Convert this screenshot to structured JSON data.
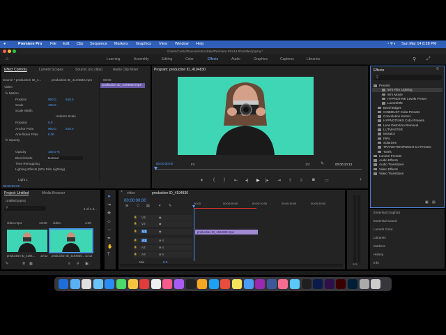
{
  "menubar": {
    "app": "Premiere Pro",
    "items": [
      "File",
      "Edit",
      "Clip",
      "Sequence",
      "Markers",
      "Graphics",
      "View",
      "Window",
      "Help"
    ],
    "datetime": "Sun Mar 14  8:28 PM"
  },
  "path": "/Users/Curtis/Documents/Adobe/Premiere Pro/14.0/Untitled.prproj *",
  "workspaces": [
    "Learning",
    "Assembly",
    "Editing",
    "Color",
    "Effects",
    "Audio",
    "Graphics",
    "Captions",
    "Libraries"
  ],
  "workspace_active": "Effects",
  "effect_controls": {
    "tabs": [
      "Effect Controls",
      "Lumetri Scopes",
      "Source: (no clips)",
      "Audio Clip Mixer"
    ],
    "source_label": "Source * production ID_4...",
    "clip_label": "production ID_4194830.mp4",
    "timecode_top": "00:00",
    "video_header": "Video",
    "rows": [
      {
        "label": "fx  Motion",
        "v1": "",
        "v2": ""
      },
      {
        "label": "Position",
        "v1": "960.0",
        "v2": "540.0"
      },
      {
        "label": "Scale",
        "v1": "100.0",
        "v2": ""
      },
      {
        "label": "Scale Width",
        "v1": "",
        "v2": ""
      },
      {
        "label": "",
        "v1": "",
        "v2": "Uniform Scale"
      },
      {
        "label": "Rotation",
        "v1": "0.0",
        "v2": ""
      },
      {
        "label": "Anchor Point",
        "v1": "960.0",
        "v2": "540.0"
      },
      {
        "label": "Anti-flicker Filter",
        "v1": "0.00",
        "v2": ""
      },
      {
        "label": "fx  Opacity",
        "v1": "",
        "v2": ""
      },
      {
        "label": "",
        "v1": "",
        "v2": ""
      },
      {
        "label": "Opacity",
        "v1": "100.0 %",
        "v2": ""
      },
      {
        "label": "Blend Mode",
        "v1": "Normal",
        "v2": ""
      },
      {
        "label": "Time Remapping",
        "v1": "",
        "v2": ""
      },
      {
        "label": "Lighting Effects (90's Film Lighting)",
        "v1": "",
        "v2": ""
      }
    ],
    "light_label": "Light 1",
    "timecode_bottom": "00:00:00:00"
  },
  "program": {
    "title": "Program: production ID_4194830",
    "timecode": "00:00:00:00",
    "fit": "Fit",
    "fraction": "1/2",
    "duration": "00:00:10:12"
  },
  "effects": {
    "title": "Effects",
    "items": [
      {
        "label": "Presets",
        "indent": 0
      },
      {
        "label": "90's Film Lighting",
        "indent": 2,
        "selected": true
      },
      {
        "label": "90's Movie",
        "indent": 2
      },
      {
        "label": "HYPNOTINK Levels Preset",
        "indent": 2
      },
      {
        "label": "Lumetri9ht",
        "indent": 2
      },
      {
        "label": "Bevel Edges",
        "indent": 1
      },
      {
        "label": "CINEDUST Color Presets",
        "indent": 1
      },
      {
        "label": "Convolution Kernel",
        "indent": 1
      },
      {
        "label": "HYPNOTINKS Color Presets",
        "indent": 1
      },
      {
        "label": "Lens Distortion Removal",
        "indent": 1
      },
      {
        "label": "LUTMASTER",
        "indent": 1
      },
      {
        "label": "Mosaics",
        "indent": 1
      },
      {
        "label": "PiPs",
        "indent": 1
      },
      {
        "label": "Solarizes",
        "indent": 1
      },
      {
        "label": "TRANSITIONPUNCH 5.0 Presets",
        "indent": 1
      },
      {
        "label": "Twirls",
        "indent": 1
      },
      {
        "label": "Lumetri Presets",
        "indent": 0
      },
      {
        "label": "Audio Effects",
        "indent": 0
      },
      {
        "label": "Audio Transitions",
        "indent": 0
      },
      {
        "label": "Video Effects",
        "indent": 0
      },
      {
        "label": "Video Transitions",
        "indent": 0
      }
    ],
    "other_panels": [
      "Essential Graphics",
      "Essential Sound",
      "Lumetri Color",
      "Libraries",
      "Markers",
      "History",
      "Info"
    ]
  },
  "project": {
    "tabs": [
      "Project: Untitled",
      "Media Browser"
    ],
    "file": "Untitled.prproj",
    "count": "1 of 4 it...",
    "bins": [
      {
        "name": "video.mp4",
        "dur": "13:30"
      },
      {
        "name": "video",
        "dur": "4:20"
      }
    ],
    "clips": [
      {
        "name": "production ID_4194...",
        "dur": "10:12"
      },
      {
        "name": "production ID_4194830...",
        "dur": "10:12"
      }
    ]
  },
  "timeline": {
    "tabs": [
      "video",
      "production ID_4194830"
    ],
    "timecode": "00:00:00:00",
    "ruler": [
      "00:00",
      "00:00:05:00",
      "00:00:10:00",
      "00:00:15:00",
      "00:00:20:00"
    ],
    "tracks": [
      "V3",
      "V2",
      "V1",
      "A1",
      "A2",
      "A3"
    ],
    "clip_label": "production ID_4194830.mp4",
    "mix_label": "Mix",
    "mix_value": "0.0"
  },
  "colors": {
    "menubar": "#2f5fb8",
    "panel": "#232323",
    "accent_blue": "#4ea0ff",
    "timeline_clip": "#a08ad6",
    "green_screen": "#3fd6b5"
  }
}
